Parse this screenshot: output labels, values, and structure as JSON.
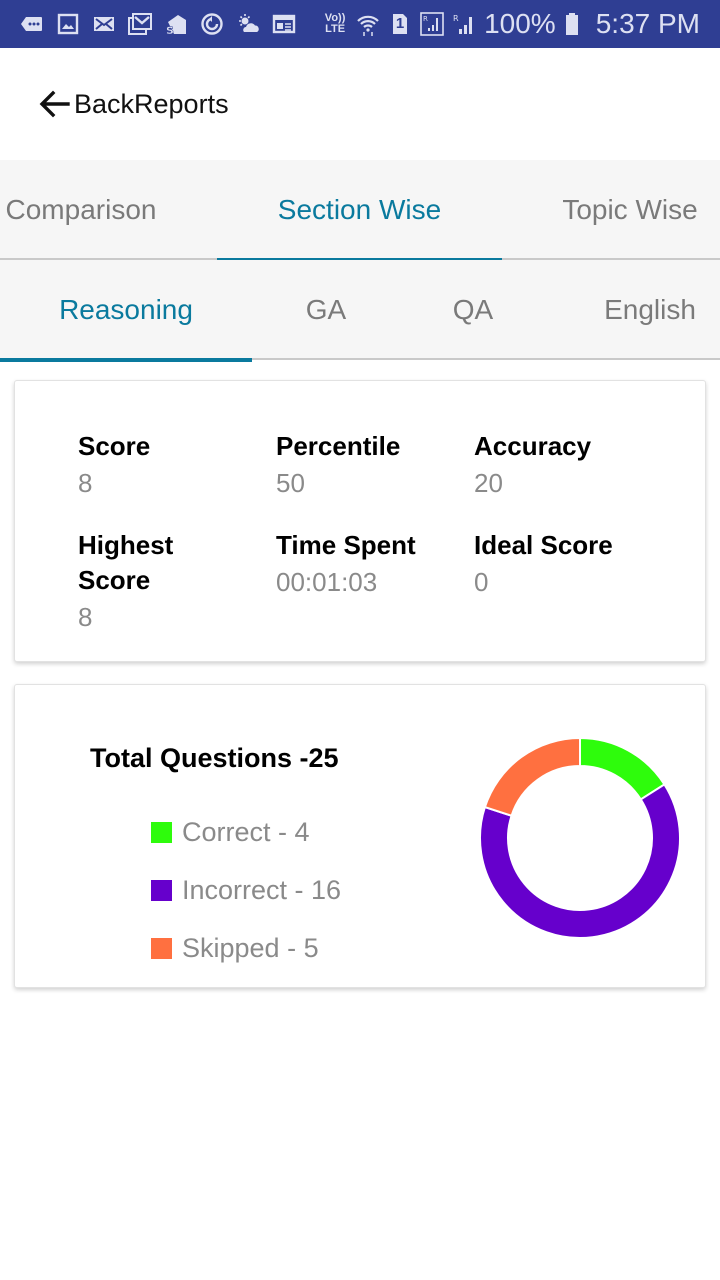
{
  "status_bar": {
    "left_icons": [
      "messages-icon",
      "gallery-icon",
      "mail-icon",
      "gmail-icon",
      "app-s-icon",
      "sync-icon",
      "weather-icon",
      "news-icon"
    ],
    "volte_top": "Vo))",
    "volte_bottom": "LTE",
    "sim_label": "1",
    "battery_percent": "100%",
    "time": "5:37 PM"
  },
  "header": {
    "back_label": "BackReports"
  },
  "main_tabs": [
    {
      "label": "Comparison",
      "active": false
    },
    {
      "label": "Section Wise",
      "active": true
    },
    {
      "label": "Topic Wise",
      "active": false
    }
  ],
  "sub_tabs": [
    {
      "label": "Reasoning",
      "active": true
    },
    {
      "label": "GA",
      "active": false
    },
    {
      "label": "QA",
      "active": false
    },
    {
      "label": "English",
      "active": false
    }
  ],
  "stats": [
    {
      "label": "Score",
      "value": "8"
    },
    {
      "label": "Percentile",
      "value": "50"
    },
    {
      "label": "Accuracy",
      "value": "20"
    },
    {
      "label": "Highest Score",
      "value": "8"
    },
    {
      "label": "Time Spent",
      "value": "00:01:03"
    },
    {
      "label": "Ideal Score",
      "value": "0"
    }
  ],
  "summary": {
    "title": "Total Questions -25",
    "legend": [
      {
        "label": "Correct - 4",
        "color": "#2efc0c"
      },
      {
        "label": "Incorrect - 16",
        "color": "#6600cc"
      },
      {
        "label": "Skipped - 5",
        "color": "#ff7040"
      }
    ]
  },
  "chart_data": {
    "type": "pie",
    "variant": "donut",
    "title": "Total Questions -25",
    "categories": [
      "Correct",
      "Incorrect",
      "Skipped"
    ],
    "values": [
      4,
      16,
      5
    ],
    "colors": [
      "#2efc0c",
      "#6600cc",
      "#ff7040"
    ],
    "start_angle_deg": 0,
    "direction": "clockwise",
    "legend": "left"
  }
}
